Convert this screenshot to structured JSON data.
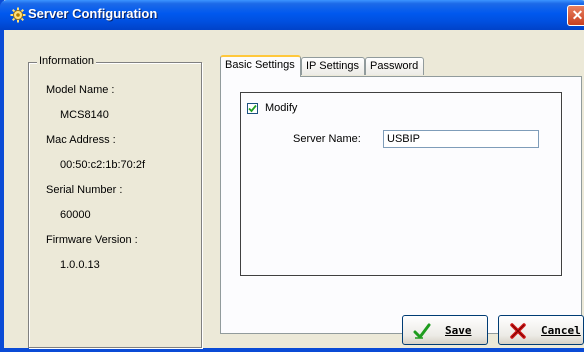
{
  "window": {
    "title": "Server Configuration"
  },
  "info": {
    "group_title": "Information",
    "fields": [
      {
        "label": "Model Name :",
        "value": "MCS8140"
      },
      {
        "label": "Mac Address :",
        "value": "00:50:c2:1b:70:2f"
      },
      {
        "label": "Serial Number :",
        "value": "60000"
      },
      {
        "label": "Firmware Version :",
        "value": "1.0.0.13"
      }
    ]
  },
  "tabs": [
    {
      "label": "Basic Settings",
      "active": true
    },
    {
      "label": "IP Settings",
      "active": false
    },
    {
      "label": "Password",
      "active": false
    }
  ],
  "basic": {
    "modify_label": "Modify",
    "modify_checked": true,
    "server_name_label": "Server Name:",
    "server_name_value": "USBIP"
  },
  "buttons": {
    "save": "Save",
    "cancel": "Cancel"
  },
  "icons": {
    "title": "gear-icon",
    "close": "close-icon",
    "save": "checkmark-icon",
    "cancel": "x-icon"
  }
}
